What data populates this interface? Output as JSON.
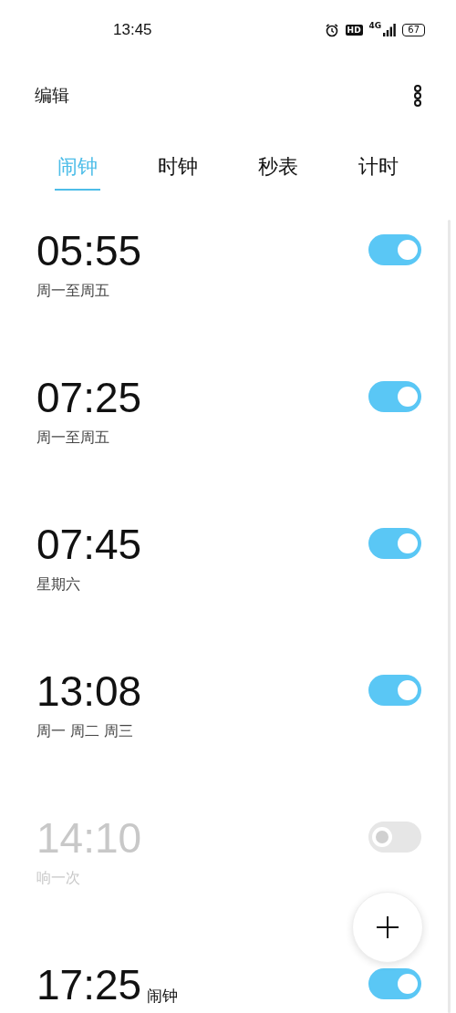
{
  "status_bar": {
    "time": "13:45",
    "hd": "HD",
    "network": "4G",
    "battery": "67"
  },
  "header": {
    "edit": "编辑"
  },
  "tabs": [
    {
      "label": "闹钟",
      "selected": true
    },
    {
      "label": "时钟",
      "selected": false
    },
    {
      "label": "秒表",
      "selected": false
    },
    {
      "label": "计时",
      "selected": false
    }
  ],
  "alarms": [
    {
      "time": "05:55",
      "repeat": "周一至周五",
      "on": true
    },
    {
      "time": "07:25",
      "repeat": "周一至周五",
      "on": true
    },
    {
      "time": "07:45",
      "repeat": "星期六",
      "on": true
    },
    {
      "time": "13:08",
      "repeat": "周一 周二 周三",
      "on": true
    },
    {
      "time": "14:10",
      "repeat": "响一次",
      "on": false
    },
    {
      "time": "17:25",
      "label": "闹钟",
      "on": true
    }
  ]
}
